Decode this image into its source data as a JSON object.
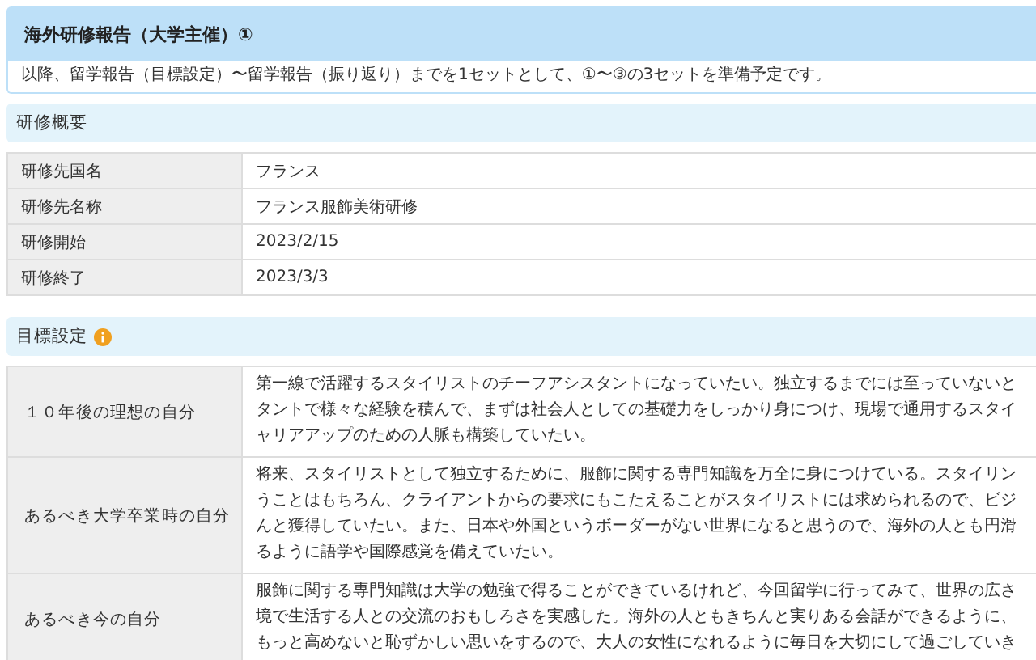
{
  "report": {
    "title": "海外研修報告（大学主催）①",
    "note": "以降、留学報告（目標設定）〜留学報告（振り返り）までを1セットとして、①〜③の3セットを準備予定です。"
  },
  "overview": {
    "heading": "研修概要",
    "rows": [
      {
        "label": "研修先国名",
        "value": "フランス"
      },
      {
        "label": "研修先名称",
        "value": "フランス服飾美術研修"
      },
      {
        "label": "研修開始",
        "value": "2023/2/15"
      },
      {
        "label": "研修終了",
        "value": "2023/3/3"
      }
    ]
  },
  "goals": {
    "heading": "目標設定",
    "info": true,
    "rows": [
      {
        "label": "１０年後の理想の自分",
        "lines": [
          "第一線で活躍するスタイリストのチーフアシスタントになっていたい。独立するまでには至っていないと",
          "タントで様々な経験を積んで、まずは社会人としての基礎力をしっかり身につけ、現場で通用するスタイ",
          "ャリアアップのための人脈も構築していたい。"
        ]
      },
      {
        "label": "あるべき大学卒業時の自分",
        "lines": [
          "将来、スタイリストとして独立するために、服飾に関する専門知識を万全に身につけている。スタイリン",
          "うことはもちろん、クライアントからの要求にもこたえることがスタイリストには求められるので、ビジ",
          "んと獲得していたい。また、日本や外国というボーダーがない世界になると思うので、海外の人とも円滑",
          "るように語学や国際感覚を備えていたい。"
        ]
      },
      {
        "label": "あるべき今の自分",
        "lines": [
          "服飾に関する専門知識は大学の勉強で得ることができているけれど、今回留学に行ってみて、世界の広さ",
          "境で生活する人との交流のおもしろさを実感した。海外の人ともきちんと実りある会話ができるように、",
          "もっと高めないと恥ずかしい思いをするので、大人の女性になれるように毎日を大切にして過ごしていき"
        ]
      }
    ]
  }
}
